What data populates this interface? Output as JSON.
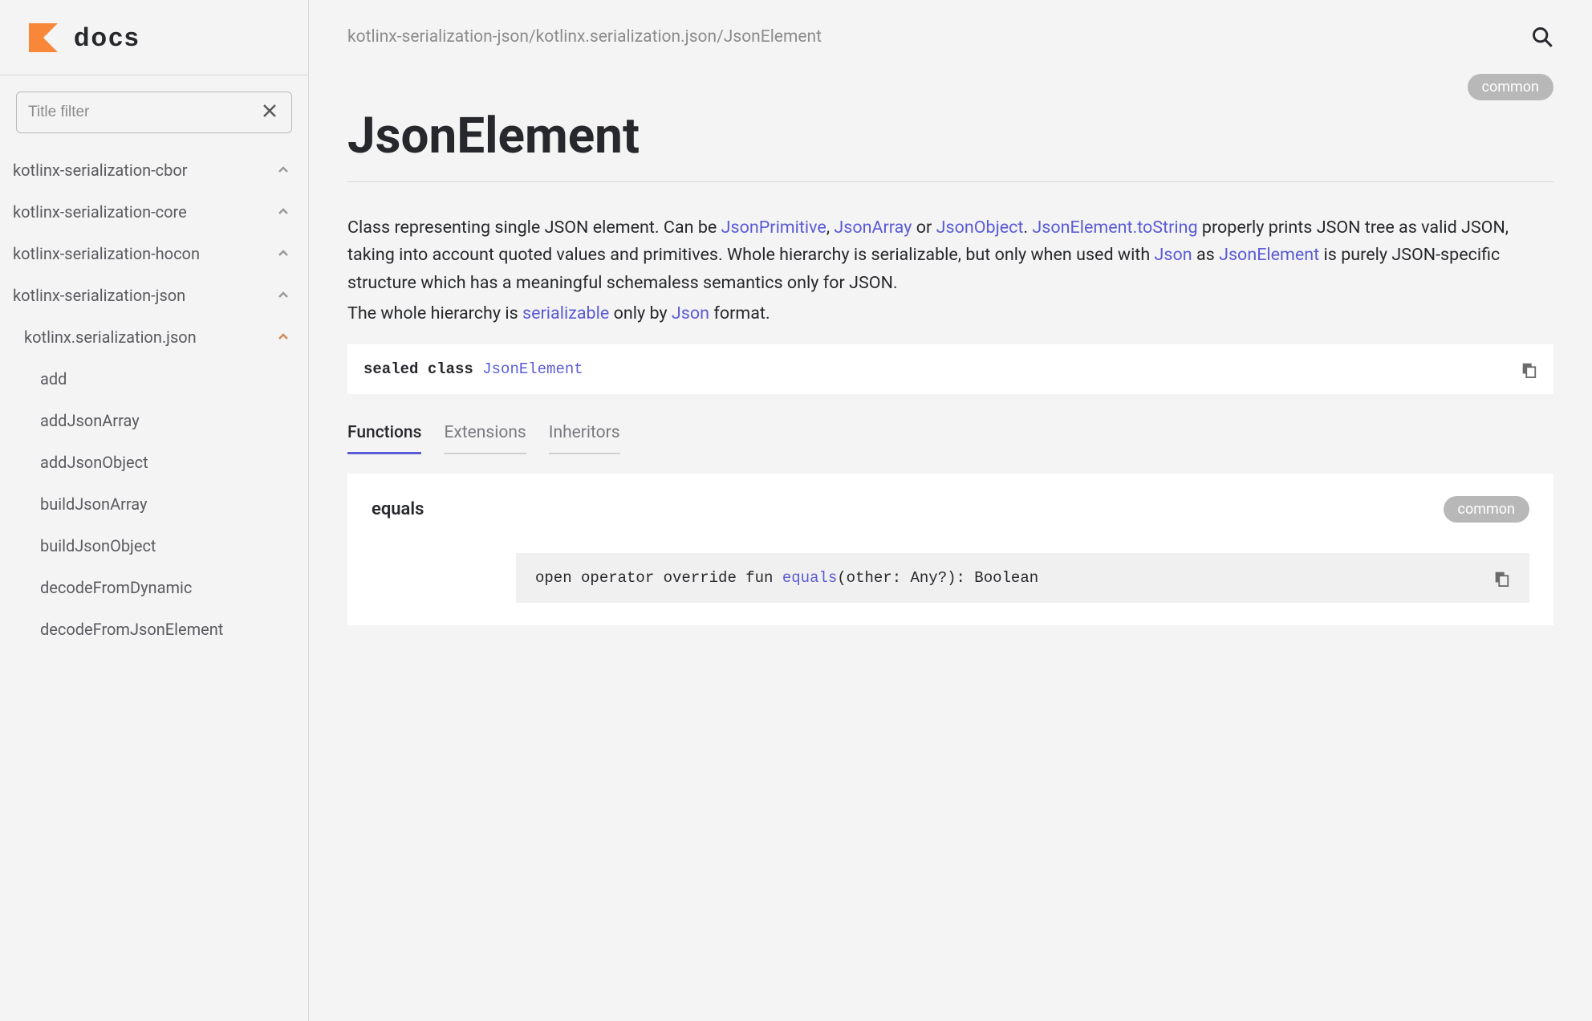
{
  "logo": {
    "docs_label": "docs"
  },
  "filter": {
    "placeholder": "Title filter"
  },
  "sidebar": {
    "groups": [
      {
        "label": "kotlinx-serialization-cbor"
      },
      {
        "label": "kotlinx-serialization-core"
      },
      {
        "label": "kotlinx-serialization-hocon"
      },
      {
        "label": "kotlinx-serialization-json"
      }
    ],
    "subpackage": "kotlinx.serialization.json",
    "items": [
      "add",
      "addJsonArray",
      "addJsonObject",
      "buildJsonArray",
      "buildJsonObject",
      "decodeFromDynamic",
      "decodeFromJsonElement"
    ]
  },
  "breadcrumb": "kotlinx-serialization-json/kotlinx.serialization.json/JsonElement",
  "badges": {
    "common": "common"
  },
  "page": {
    "title": "JsonElement",
    "desc_part1": "Class representing single JSON element. Can be ",
    "link_jsonprimitive": "JsonPrimitive",
    "comma1": ", ",
    "link_jsonarray": "JsonArray",
    "or": " or ",
    "link_jsonobject": "JsonObject",
    "period1": ". ",
    "link_tostring": "JsonElement.toString",
    "desc_part2": " properly prints JSON tree as valid JSON, taking into account quoted values and primitives. Whole hierarchy is serializable, but only when used with ",
    "link_json": "Json",
    "desc_part3": " as ",
    "link_jsonelement": "JsonElement",
    "desc_part4": " is purely JSON-specific structure which has a meaningful schemaless semantics only for JSON.",
    "desc_line2a": "The whole hierarchy is ",
    "link_serializable": "serializable",
    "desc_line2b": " only by ",
    "link_json2": "Json",
    "desc_line2c": " format."
  },
  "signature": {
    "modifiers": "sealed class ",
    "name": "JsonElement"
  },
  "tabs": {
    "functions": "Functions",
    "extensions": "Extensions",
    "inheritors": "Inheritors"
  },
  "member": {
    "name": "equals",
    "badge": "common",
    "sig_prefix": "open operator override fun ",
    "sig_fn": "equals",
    "sig_suffix": "(other: Any?): Boolean"
  }
}
